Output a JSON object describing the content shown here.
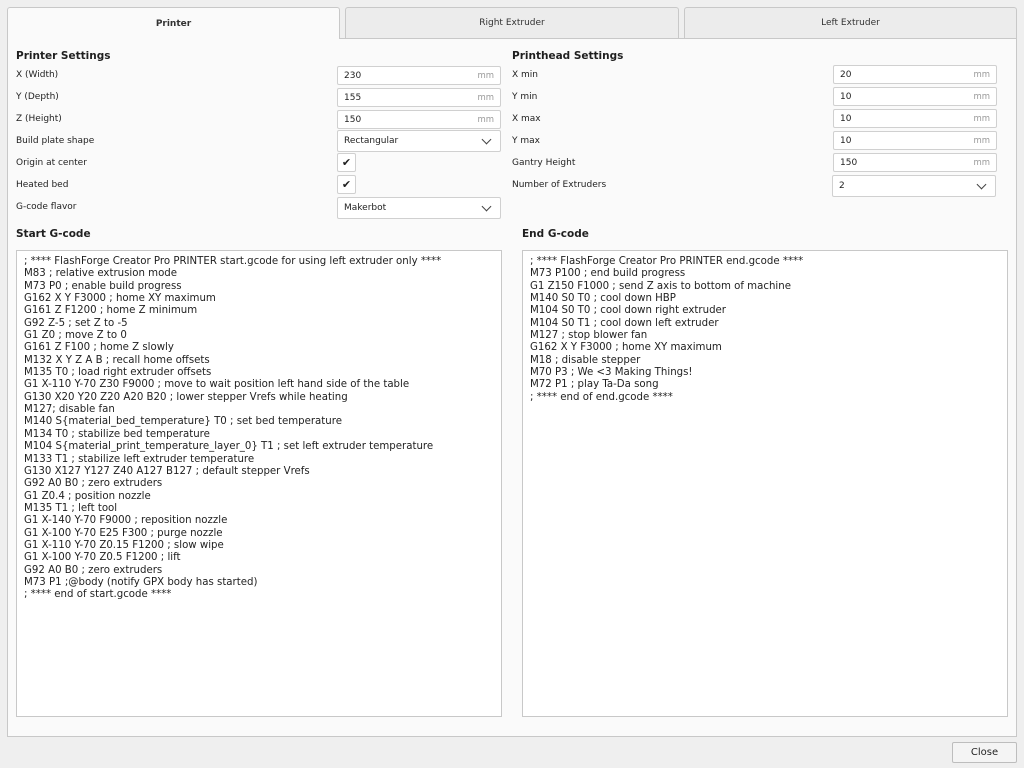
{
  "tabs": [
    "Printer",
    "Right Extruder",
    "Left Extruder"
  ],
  "printer": {
    "title": "Printer Settings",
    "x_label": "X (Width)",
    "x": "230",
    "y_label": "Y (Depth)",
    "y": "155",
    "z_label": "Z (Height)",
    "z": "150",
    "shape_label": "Build plate shape",
    "shape": "Rectangular",
    "origin_label": "Origin at center",
    "origin_checked": true,
    "heated_label": "Heated bed",
    "heated_checked": true,
    "flavor_label": "G-code flavor",
    "flavor": "Makerbot",
    "unit": "mm"
  },
  "printhead": {
    "title": "Printhead Settings",
    "xmin_label": "X min",
    "xmin": "20",
    "ymin_label": "Y min",
    "ymin": "10",
    "xmax_label": "X max",
    "xmax": "10",
    "ymax_label": "Y max",
    "ymax": "10",
    "gantry_label": "Gantry Height",
    "gantry": "150",
    "extruders_label": "Number of Extruders",
    "extruders": "2",
    "unit": "mm"
  },
  "start_gcode": {
    "title": "Start G-code",
    "text": "; **** FlashForge Creator Pro PRINTER start.gcode for using left extruder only ****\nM83 ; relative extrusion mode\nM73 P0 ; enable build progress\nG162 X Y F3000 ; home XY maximum\nG161 Z F1200 ; home Z minimum\nG92 Z-5 ; set Z to -5\nG1 Z0 ; move Z to 0\nG161 Z F100 ; home Z slowly\nM132 X Y Z A B ; recall home offsets\nM135 T0 ; load right extruder offsets\nG1 X-110 Y-70 Z30 F9000 ; move to wait position left hand side of the table\nG130 X20 Y20 Z20 A20 B20 ; lower stepper Vrefs while heating\nM127; disable fan\nM140 S{material_bed_temperature} T0 ; set bed temperature\nM134 T0 ; stabilize bed temperature\nM104 S{material_print_temperature_layer_0} T1 ; set left extruder temperature\nM133 T1 ; stabilize left extruder temperature\nG130 X127 Y127 Z40 A127 B127 ; default stepper Vrefs\nG92 A0 B0 ; zero extruders\nG1 Z0.4 ; position nozzle\nM135 T1 ; left tool\nG1 X-140 Y-70 F9000 ; reposition nozzle\nG1 X-100 Y-70 E25 F300 ; purge nozzle\nG1 X-110 Y-70 Z0.15 F1200 ; slow wipe\nG1 X-100 Y-70 Z0.5 F1200 ; lift\nG92 A0 B0 ; zero extruders\nM73 P1 ;@body (notify GPX body has started)\n; **** end of start.gcode ****"
  },
  "end_gcode": {
    "title": "End G-code",
    "text": "; **** FlashForge Creator Pro PRINTER end.gcode ****\nM73 P100 ; end build progress\nG1 Z150 F1000 ; send Z axis to bottom of machine\nM140 S0 T0 ; cool down HBP\nM104 S0 T0 ; cool down right extruder\nM104 S0 T1 ; cool down left extruder\nM127 ; stop blower fan\nG162 X Y F3000 ; home XY maximum\nM18 ; disable stepper\nM70 P3 ; We <3 Making Things!\nM72 P1 ; play Ta-Da song\n; **** end of end.gcode ****"
  },
  "close_label": "Close"
}
